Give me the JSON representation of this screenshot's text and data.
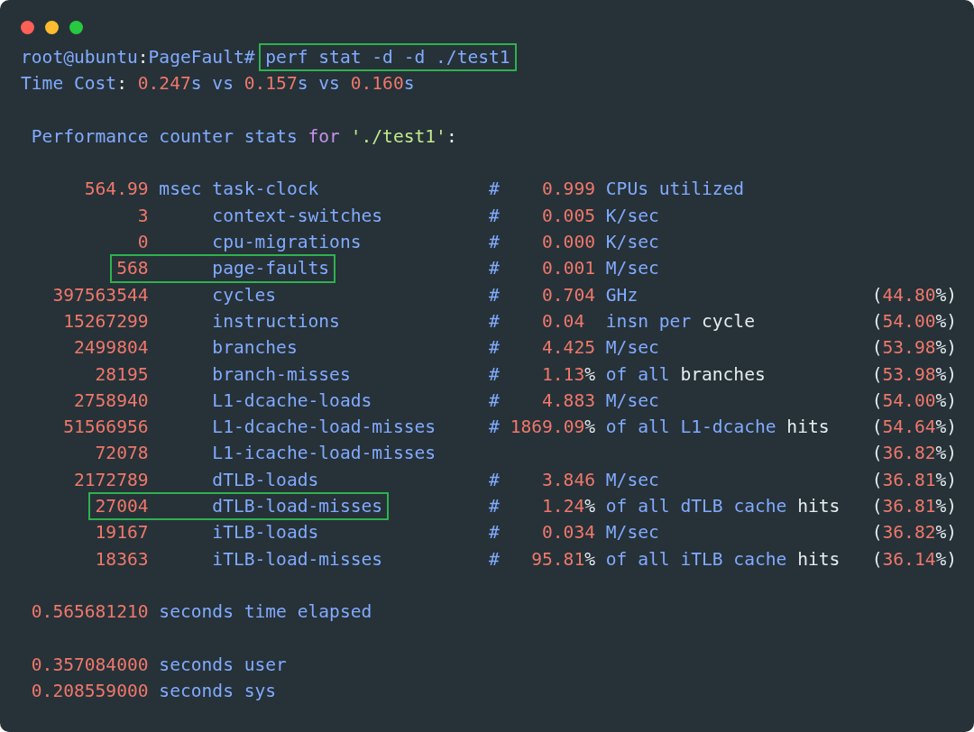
{
  "lines": [
    {
      "kind": "text",
      "segments": [
        {
          "text": "root@ubuntu",
          "color": "#82aaff"
        },
        {
          "text": ":",
          "color": "#e6ebee"
        },
        {
          "text": "PageFault#",
          "color": "#82aaff"
        },
        {
          "text": " perf stat -d -d ./test1",
          "color": "#82aaff",
          "highlighted": true
        }
      ]
    },
    {
      "kind": "text",
      "segments": [
        {
          "text": "Time Cost",
          "color": "#82aaff"
        },
        {
          "text": ": ",
          "color": "#e6ebee"
        },
        {
          "text": "0.247",
          "color": "#f0776b"
        },
        {
          "text": "s vs ",
          "color": "#82aaff"
        },
        {
          "text": "0.157",
          "color": "#f0776b"
        },
        {
          "text": "s vs ",
          "color": "#82aaff"
        },
        {
          "text": "0.160",
          "color": "#f0776b"
        },
        {
          "text": "s",
          "color": "#82aaff"
        }
      ]
    },
    {
      "kind": "blank"
    },
    {
      "kind": "text",
      "segments": [
        {
          "text": " Performance counter stats ",
          "color": "#82aaff"
        },
        {
          "text": "for",
          "color": "#c792ea"
        },
        {
          "text": " './test1'",
          "color": "#c3e88d"
        },
        {
          "text": ":",
          "color": "#e6ebee"
        }
      ]
    },
    {
      "kind": "blank"
    },
    {
      "kind": "text",
      "segments": [
        {
          "text": "      564.99",
          "color": "#f0776b"
        },
        {
          "text": " msec task-clock                #    ",
          "color": "#82aaff"
        },
        {
          "text": "0.999",
          "color": "#f0776b"
        },
        {
          "text": " CPUs utilized",
          "color": "#82aaff"
        }
      ]
    },
    {
      "kind": "text",
      "segments": [
        {
          "text": "           3",
          "color": "#f0776b"
        },
        {
          "text": "      context-switches          #    ",
          "color": "#82aaff"
        },
        {
          "text": "0.005",
          "color": "#f0776b"
        },
        {
          "text": " K/sec",
          "color": "#82aaff"
        }
      ]
    },
    {
      "kind": "text",
      "segments": [
        {
          "text": "           0",
          "color": "#f0776b"
        },
        {
          "text": "      cpu-migrations            #    ",
          "color": "#82aaff"
        },
        {
          "text": "0.000",
          "color": "#f0776b"
        },
        {
          "text": " K/sec",
          "color": "#82aaff"
        }
      ]
    },
    {
      "kind": "text",
      "segments": [
        {
          "text": "         568",
          "color": "#f0776b",
          "highlighted": true
        },
        {
          "text": "      page-faults",
          "color": "#82aaff",
          "highlighted": true
        },
        {
          "text": "               #    ",
          "color": "#82aaff"
        },
        {
          "text": "0.001",
          "color": "#f0776b"
        },
        {
          "text": " M/sec",
          "color": "#82aaff"
        }
      ]
    },
    {
      "kind": "text",
      "segments": [
        {
          "text": "   397563544",
          "color": "#f0776b"
        },
        {
          "text": "      cycles                    #    ",
          "color": "#82aaff"
        },
        {
          "text": "0.704",
          "color": "#f0776b"
        },
        {
          "text": " GHz",
          "color": "#82aaff"
        },
        {
          "text": "                      (",
          "color": "#e6ebee"
        },
        {
          "text": "44.80",
          "color": "#f0776b"
        },
        {
          "text": "%)",
          "color": "#e6ebee"
        }
      ]
    },
    {
      "kind": "text",
      "segments": [
        {
          "text": "    15267299",
          "color": "#f0776b"
        },
        {
          "text": "      instructions              #    ",
          "color": "#82aaff"
        },
        {
          "text": "0.04",
          "color": "#f0776b"
        },
        {
          "text": "  insn per",
          "color": "#82aaff"
        },
        {
          "text": " cycle           (",
          "color": "#e6ebee"
        },
        {
          "text": "54.00",
          "color": "#f0776b"
        },
        {
          "text": "%)",
          "color": "#e6ebee"
        }
      ]
    },
    {
      "kind": "text",
      "segments": [
        {
          "text": "     2499804",
          "color": "#f0776b"
        },
        {
          "text": "      branches                  #    ",
          "color": "#82aaff"
        },
        {
          "text": "4.425",
          "color": "#f0776b"
        },
        {
          "text": " M/sec",
          "color": "#82aaff"
        },
        {
          "text": "                    (",
          "color": "#e6ebee"
        },
        {
          "text": "53.98",
          "color": "#f0776b"
        },
        {
          "text": "%)",
          "color": "#e6ebee"
        }
      ]
    },
    {
      "kind": "text",
      "segments": [
        {
          "text": "       28195",
          "color": "#f0776b"
        },
        {
          "text": "      branch-misses             #    ",
          "color": "#82aaff"
        },
        {
          "text": "1.13",
          "color": "#f0776b"
        },
        {
          "text": "%",
          "color": "#e6ebee"
        },
        {
          "text": " of all",
          "color": "#82aaff"
        },
        {
          "text": " branches          (",
          "color": "#e6ebee"
        },
        {
          "text": "53.98",
          "color": "#f0776b"
        },
        {
          "text": "%)",
          "color": "#e6ebee"
        }
      ]
    },
    {
      "kind": "text",
      "segments": [
        {
          "text": "     2758940",
          "color": "#f0776b"
        },
        {
          "text": "      L1-dcache-loads           #    ",
          "color": "#82aaff"
        },
        {
          "text": "4.883",
          "color": "#f0776b"
        },
        {
          "text": " M/sec",
          "color": "#82aaff"
        },
        {
          "text": "                    (",
          "color": "#e6ebee"
        },
        {
          "text": "54.00",
          "color": "#f0776b"
        },
        {
          "text": "%)",
          "color": "#e6ebee"
        }
      ]
    },
    {
      "kind": "text",
      "segments": [
        {
          "text": "    51566956",
          "color": "#f0776b"
        },
        {
          "text": "      L1-dcache-load-misses     # ",
          "color": "#82aaff"
        },
        {
          "text": "1869.09",
          "color": "#f0776b"
        },
        {
          "text": "%",
          "color": "#e6ebee"
        },
        {
          "text": " of all L1-dcache",
          "color": "#82aaff"
        },
        {
          "text": " hits    (",
          "color": "#e6ebee"
        },
        {
          "text": "54.64",
          "color": "#f0776b"
        },
        {
          "text": "%)",
          "color": "#e6ebee"
        }
      ]
    },
    {
      "kind": "text",
      "segments": [
        {
          "text": "       72078",
          "color": "#f0776b"
        },
        {
          "text": "      L1-icache-load-misses",
          "color": "#82aaff"
        },
        {
          "text": "                                         (",
          "color": "#e6ebee"
        },
        {
          "text": "36.82",
          "color": "#f0776b"
        },
        {
          "text": "%)",
          "color": "#e6ebee"
        }
      ]
    },
    {
      "kind": "text",
      "segments": [
        {
          "text": "     2172789",
          "color": "#f0776b"
        },
        {
          "text": "      dTLB-loads                #    ",
          "color": "#82aaff"
        },
        {
          "text": "3.846",
          "color": "#f0776b"
        },
        {
          "text": " M/sec",
          "color": "#82aaff"
        },
        {
          "text": "                    (",
          "color": "#e6ebee"
        },
        {
          "text": "36.81",
          "color": "#f0776b"
        },
        {
          "text": "%)",
          "color": "#e6ebee"
        }
      ]
    },
    {
      "kind": "text",
      "segments": [
        {
          "text": "       27004",
          "color": "#f0776b",
          "highlighted": true
        },
        {
          "text": "      dTLB-load-misses",
          "color": "#82aaff",
          "highlighted": true
        },
        {
          "text": "          #    ",
          "color": "#82aaff"
        },
        {
          "text": "1.24",
          "color": "#f0776b"
        },
        {
          "text": "%",
          "color": "#e6ebee"
        },
        {
          "text": " of all dTLB cache",
          "color": "#82aaff"
        },
        {
          "text": " hits   (",
          "color": "#e6ebee"
        },
        {
          "text": "36.81",
          "color": "#f0776b"
        },
        {
          "text": "%)",
          "color": "#e6ebee"
        }
      ]
    },
    {
      "kind": "text",
      "segments": [
        {
          "text": "       19167",
          "color": "#f0776b"
        },
        {
          "text": "      iTLB-loads                #    ",
          "color": "#82aaff"
        },
        {
          "text": "0.034",
          "color": "#f0776b"
        },
        {
          "text": " M/sec",
          "color": "#82aaff"
        },
        {
          "text": "                    (",
          "color": "#e6ebee"
        },
        {
          "text": "36.82",
          "color": "#f0776b"
        },
        {
          "text": "%)",
          "color": "#e6ebee"
        }
      ]
    },
    {
      "kind": "text",
      "segments": [
        {
          "text": "       18363",
          "color": "#f0776b"
        },
        {
          "text": "      iTLB-load-misses          #   ",
          "color": "#82aaff"
        },
        {
          "text": "95.81",
          "color": "#f0776b"
        },
        {
          "text": "%",
          "color": "#e6ebee"
        },
        {
          "text": " of all iTLB cache",
          "color": "#82aaff"
        },
        {
          "text": " hits   (",
          "color": "#e6ebee"
        },
        {
          "text": "36.14",
          "color": "#f0776b"
        },
        {
          "text": "%)",
          "color": "#e6ebee"
        }
      ]
    },
    {
      "kind": "blank"
    },
    {
      "kind": "text",
      "segments": [
        {
          "text": " 0.565681210",
          "color": "#f0776b"
        },
        {
          "text": " seconds time elapsed",
          "color": "#82aaff"
        }
      ]
    },
    {
      "kind": "blank"
    },
    {
      "kind": "text",
      "segments": [
        {
          "text": " 0.357084000",
          "color": "#f0776b"
        },
        {
          "text": " seconds user",
          "color": "#82aaff"
        }
      ]
    },
    {
      "kind": "text",
      "segments": [
        {
          "text": " 0.208559000",
          "color": "#f0776b"
        },
        {
          "text": " seconds sys",
          "color": "#82aaff"
        }
      ]
    }
  ]
}
